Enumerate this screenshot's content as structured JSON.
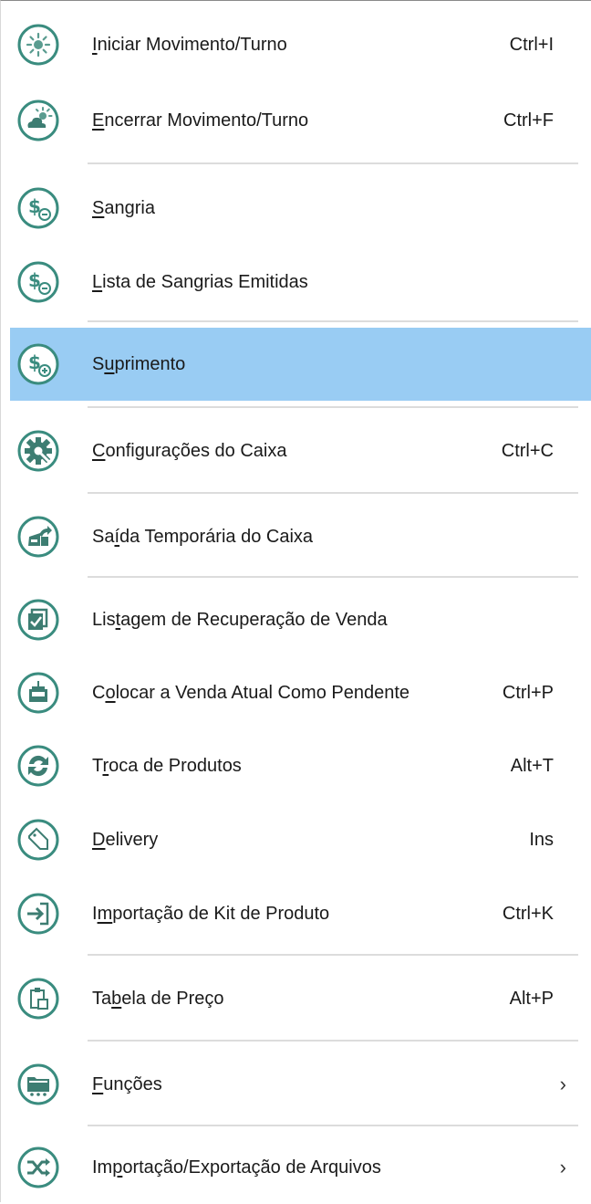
{
  "menu": {
    "accent_color": "#3a8c7f",
    "selected_color": "#99ccf3",
    "items": [
      {
        "id": "iniciar",
        "pre": "",
        "u": "I",
        "post": "niciar Movimento/Turno",
        "shortcut": "Ctrl+I",
        "icon": "sun-icon"
      },
      {
        "id": "encerrar",
        "pre": "",
        "u": "E",
        "post": "ncerrar Movimento/Turno",
        "shortcut": "Ctrl+F",
        "icon": "cloud-sun-icon"
      },
      {
        "id": "sangria",
        "pre": "",
        "u": "S",
        "post": "angria",
        "shortcut": "",
        "icon": "dollar-minus-icon"
      },
      {
        "id": "lista-sangrias",
        "pre": "",
        "u": "L",
        "post": "ista de Sangrias Emitidas",
        "shortcut": "",
        "icon": "dollar-minus-icon"
      },
      {
        "id": "suprimento",
        "pre": "S",
        "u": "u",
        "post": "primento",
        "shortcut": "",
        "icon": "dollar-plus-icon"
      },
      {
        "id": "config-caixa",
        "pre": "",
        "u": "C",
        "post": "onfigurações do Caixa",
        "shortcut": "Ctrl+C",
        "icon": "gear-wrench-icon"
      },
      {
        "id": "saida-temp",
        "pre": "Sa",
        "u": "í",
        "post": "da Temporária do Caixa",
        "shortcut": "",
        "icon": "register-exit-icon"
      },
      {
        "id": "listagem-recuperacao",
        "pre": "Lis",
        "u": "t",
        "post": "agem de Recuperação de Venda",
        "shortcut": "",
        "icon": "checklist-icon"
      },
      {
        "id": "venda-pendente",
        "pre": "C",
        "u": "o",
        "post": "locar a Venda Atual Como Pendente",
        "shortcut": "Ctrl+P",
        "icon": "pending-sale-icon"
      },
      {
        "id": "troca-produtos",
        "pre": "T",
        "u": "r",
        "post": "oca de Produtos",
        "shortcut": "Alt+T",
        "icon": "exchange-icon"
      },
      {
        "id": "delivery",
        "pre": "",
        "u": "D",
        "post": "elivery",
        "shortcut": "Ins",
        "icon": "delivery-tag-icon"
      },
      {
        "id": "importacao-kit",
        "pre": "I",
        "u": "m",
        "post": "portação de Kit de Produto",
        "shortcut": "Ctrl+K",
        "icon": "import-icon"
      },
      {
        "id": "tabela-preco",
        "pre": "Ta",
        "u": "b",
        "post": "ela de Preço",
        "shortcut": "Alt+P",
        "icon": "clipboard-icon"
      },
      {
        "id": "funcoes",
        "pre": "",
        "u": "F",
        "post": "unções",
        "shortcut": "",
        "submenu": "›",
        "icon": "folder-cart-icon"
      },
      {
        "id": "import-export",
        "pre": "Im",
        "u": "p",
        "post": "ortação/Exportação de Arquivos",
        "shortcut": "",
        "submenu": "›",
        "icon": "shuffle-icon"
      }
    ]
  }
}
